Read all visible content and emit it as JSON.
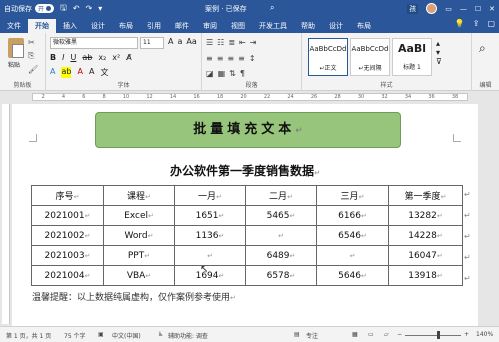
{
  "titlebar": {
    "autosave_label": "自动保存",
    "autosave_state": "开",
    "doc_title": "案例 · 已保存",
    "user_initial": "孩"
  },
  "tabs": [
    "文件",
    "开始",
    "插入",
    "设计",
    "布局",
    "引用",
    "邮件",
    "审阅",
    "视图",
    "开发工具",
    "帮助",
    "设计",
    "布局"
  ],
  "active_tab": "开始",
  "ribbon": {
    "paste_label": "粘贴",
    "clipboard_label": "剪贴板",
    "font_name": "微软雅黑",
    "font_size": "11",
    "font_group_label": "字体",
    "paragraph_group_label": "段落",
    "styles_group_label": "样式",
    "styles": [
      {
        "sample": "AaBbCcDd",
        "name": "↵正文"
      },
      {
        "sample": "AaBbCcDd",
        "name": "↵无间隔"
      },
      {
        "sample": "AaBl",
        "name": "标题 1"
      }
    ],
    "edit_label": "编辑"
  },
  "document": {
    "banner": "批量填充文本",
    "heading": "办公软件第一季度销售数据",
    "table": {
      "headers": [
        "序号",
        "课程",
        "一月",
        "二月",
        "三月",
        "第一季度"
      ],
      "rows": [
        [
          "2021001",
          "Excel",
          "1651",
          "5465",
          "6166",
          "13282"
        ],
        [
          "2021002",
          "Word",
          "1136",
          "",
          "6546",
          "14228"
        ],
        [
          "2021003",
          "PPT",
          "",
          "6489",
          "",
          "16047"
        ],
        [
          "2021004",
          "VBA",
          "1694",
          "6578",
          "5646",
          "13918"
        ]
      ]
    },
    "note": "温馨提醒：以上数据纯属虚构，仅作案例参考使用"
  },
  "statusbar": {
    "page": "第 1 页，共 1 页",
    "words": "75 个字",
    "language": "中文(中国)",
    "accessibility": "辅助功能: 调查",
    "focus": "专注",
    "zoom": "140%"
  }
}
